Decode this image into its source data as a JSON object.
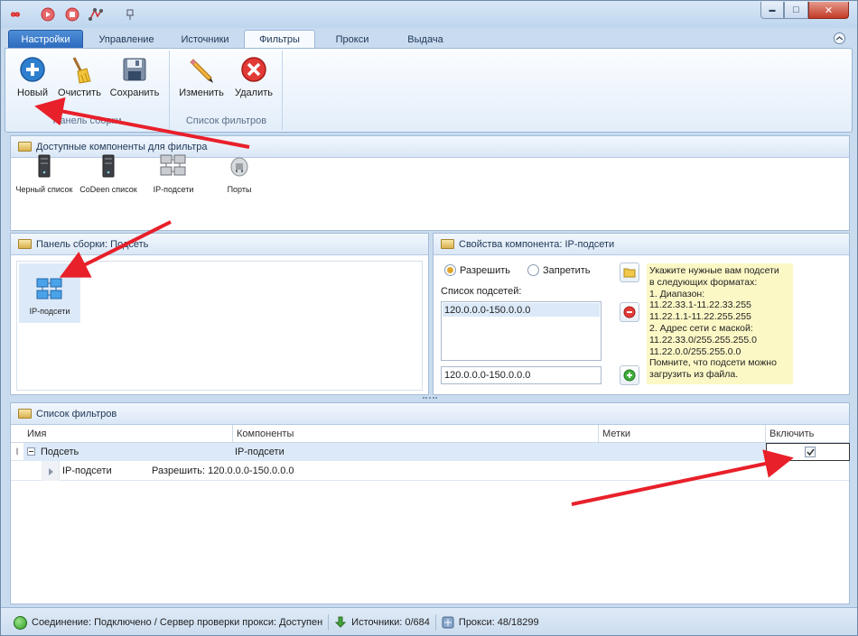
{
  "quick_access_icons": [
    "infinity-icon",
    "record-icon",
    "stop-icon",
    "network-icon",
    "pin-icon"
  ],
  "window_buttons": {
    "minimize": "▬",
    "maximize": "□",
    "close": "✕"
  },
  "tabs": [
    {
      "label": "Настройки"
    },
    {
      "label": "Управление"
    },
    {
      "label": "Источники"
    },
    {
      "label": "Фильтры"
    },
    {
      "label": "Прокси"
    },
    {
      "label": "Выдача"
    }
  ],
  "ribbon": {
    "groups": [
      {
        "caption": "Панель сборки",
        "buttons": [
          {
            "label": "Новый"
          },
          {
            "label": "Очистить"
          },
          {
            "label": "Сохранить"
          }
        ]
      },
      {
        "caption": "Список фильтров",
        "buttons": [
          {
            "label": "Изменить"
          },
          {
            "label": "Удалить"
          }
        ]
      }
    ]
  },
  "available": {
    "title": "Доступные компоненты для фильтра",
    "items": [
      {
        "label": "Черный список"
      },
      {
        "label": "CoDeen список"
      },
      {
        "label": "IP-подсети"
      },
      {
        "label": "Порты"
      }
    ]
  },
  "build_panel": {
    "title": "Панель сборки: Подсеть",
    "item": "IP-подсети"
  },
  "props": {
    "title": "Свойства компонента: IP-подсети",
    "allow": "Разрешить",
    "deny": "Запретить",
    "list_label": "Список подсетей:",
    "list_items": [
      "120.0.0.0-150.0.0.0"
    ],
    "input_value": "120.0.0.0-150.0.0.0",
    "hint": [
      "Укажите нужные вам подсети",
      "в следующих форматах:",
      "1. Диапазон:",
      "11.22.33.1-11.22.33.255",
      "11.22.1.1-11.22.255.255",
      "2. Адрес сети с маской:",
      "11.22.33.0/255.255.255.0",
      "11.22.0.0/255.255.0.0",
      "Помните, что подсети можно",
      "загрузить из файла."
    ]
  },
  "filter_list": {
    "title": "Список фильтров",
    "columns": [
      "Имя",
      "Компоненты",
      "Метки",
      "Включить"
    ],
    "row": {
      "name": "Подсеть",
      "components": "IP-подсети",
      "enabled": true
    },
    "subrow": {
      "name": "IP-подсети",
      "value": "Разрешить: 120.0.0.0-150.0.0.0"
    }
  },
  "status": {
    "connection": "Соединение: Подключено / Сервер проверки прокси: Доступен",
    "sources": "Источники: 0/684",
    "proxies": "Прокси: 48/18299"
  },
  "colors": {
    "accent": "#2c6bbd",
    "annotation_arrow": "#e8202a",
    "hint_bg": "#fcf8c6"
  }
}
